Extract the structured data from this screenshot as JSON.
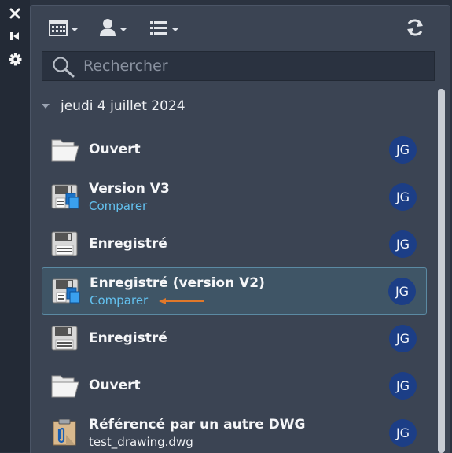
{
  "sidebar_tools": [
    {
      "icon": "close-icon"
    },
    {
      "icon": "collapse-icon"
    },
    {
      "icon": "settings-icon"
    }
  ],
  "toolbar": {
    "date_filter_icon": "calendar-icon",
    "user_filter_icon": "user-icon",
    "list_view_icon": "list-icon",
    "refresh_icon": "refresh-icon"
  },
  "search": {
    "placeholder": "Rechercher",
    "value": ""
  },
  "group": {
    "date": "jeudi 4 juillet 2024",
    "entries": [
      {
        "title": "Ouvert",
        "subtitle": "",
        "subtitle_is_link": false,
        "icon": "folder-open-icon",
        "user": "JG",
        "selected": false
      },
      {
        "title": "Version V3",
        "subtitle": "Comparer",
        "subtitle_is_link": true,
        "icon": "save-version-icon",
        "user": "JG",
        "selected": false
      },
      {
        "title": "Enregistré",
        "subtitle": "",
        "subtitle_is_link": false,
        "icon": "save-icon",
        "user": "JG",
        "selected": false
      },
      {
        "title": "Enregistré (version V2)",
        "subtitle": "Comparer",
        "subtitle_is_link": true,
        "icon": "save-version-icon",
        "user": "JG",
        "selected": true
      },
      {
        "title": "Enregistré",
        "subtitle": "",
        "subtitle_is_link": false,
        "icon": "save-icon",
        "user": "JG",
        "selected": false
      },
      {
        "title": "Ouvert",
        "subtitle": "",
        "subtitle_is_link": false,
        "icon": "folder-open-icon",
        "user": "JG",
        "selected": false
      },
      {
        "title": "Référencé par un autre DWG",
        "subtitle": "test_drawing.dwg",
        "subtitle_is_link": false,
        "icon": "clipboard-reference-icon",
        "user": "JG",
        "selected": false
      }
    ]
  },
  "colors": {
    "panel_bg": "#3b4453",
    "strip_bg": "#232a36",
    "link": "#63c1ef",
    "avatar_bg": "#1c3e86",
    "selection_bg": "#3f5566",
    "selection_border": "#5b8aa3",
    "annotation_arrow": "#e0782a"
  }
}
